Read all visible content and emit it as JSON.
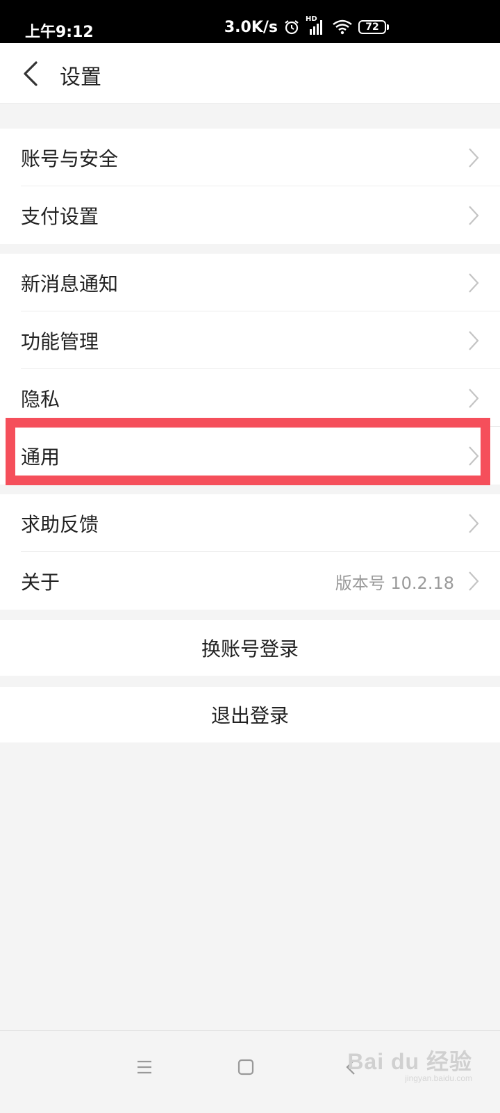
{
  "status_bar": {
    "time": "上午9:12",
    "network_speed": "3.0K/s",
    "signal_label": "HD",
    "battery": "72"
  },
  "header": {
    "title": "设置"
  },
  "groups": [
    {
      "items": [
        {
          "label": "账号与安全"
        },
        {
          "label": "支付设置"
        }
      ]
    },
    {
      "items": [
        {
          "label": "新消息通知"
        },
        {
          "label": "功能管理"
        },
        {
          "label": "隐私"
        },
        {
          "label": "通用"
        }
      ]
    },
    {
      "items": [
        {
          "label": "求助反馈"
        },
        {
          "label": "关于",
          "value": "版本号 10.2.18"
        }
      ]
    }
  ],
  "actions": {
    "switch_account": "换账号登录",
    "logout": "退出登录"
  },
  "watermark": {
    "brand": "Bai du 经验",
    "site": "jingyan.baidu.com"
  },
  "colors": {
    "highlight": "#f54f5b",
    "background": "#f4f4f4"
  }
}
